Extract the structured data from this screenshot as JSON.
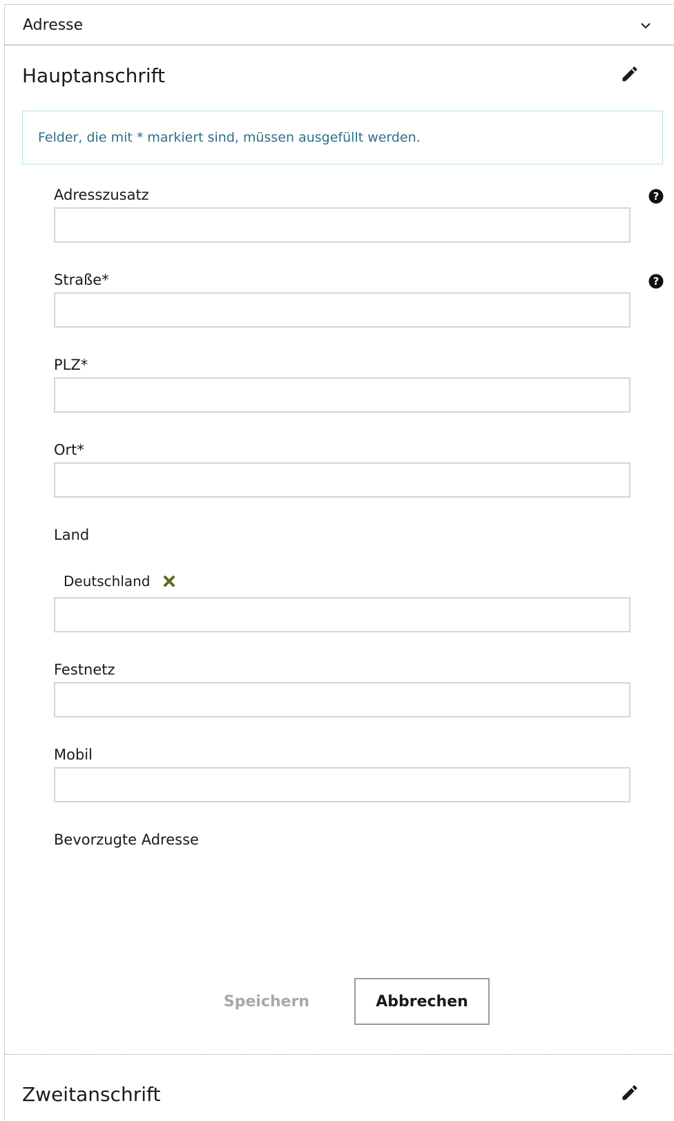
{
  "accordion": {
    "title": "Adresse"
  },
  "primary": {
    "title": "Hauptanschrift",
    "notice": "Felder, die mit * markiert sind, müssen ausgefüllt werden.",
    "fields": {
      "adresszusatz": {
        "label": "Adresszusatz",
        "value": ""
      },
      "strasse": {
        "label": "Straße*",
        "value": ""
      },
      "plz": {
        "label": "PLZ*",
        "value": ""
      },
      "ort": {
        "label": "Ort*",
        "value": ""
      },
      "land": {
        "label": "Land",
        "selected": "Deutschland",
        "value": ""
      },
      "festnetz": {
        "label": "Festnetz",
        "value": ""
      },
      "mobil": {
        "label": "Mobil",
        "value": ""
      }
    },
    "preferred_label": "Bevorzugte Adresse",
    "save_label": "Speichern",
    "cancel_label": "Abbrechen"
  },
  "secondary": {
    "title": "Zweitanschrift"
  },
  "colors": {
    "notice_text": "#2f6f84",
    "notice_border": "#b5e3e8",
    "tag_remove": "#5a6e1e",
    "disabled_text": "#a8a8a8"
  },
  "icons": {
    "accordion": "chevron-down-icon",
    "edit": "pencil-icon",
    "help": "question-circle-icon",
    "remove": "x-icon"
  }
}
